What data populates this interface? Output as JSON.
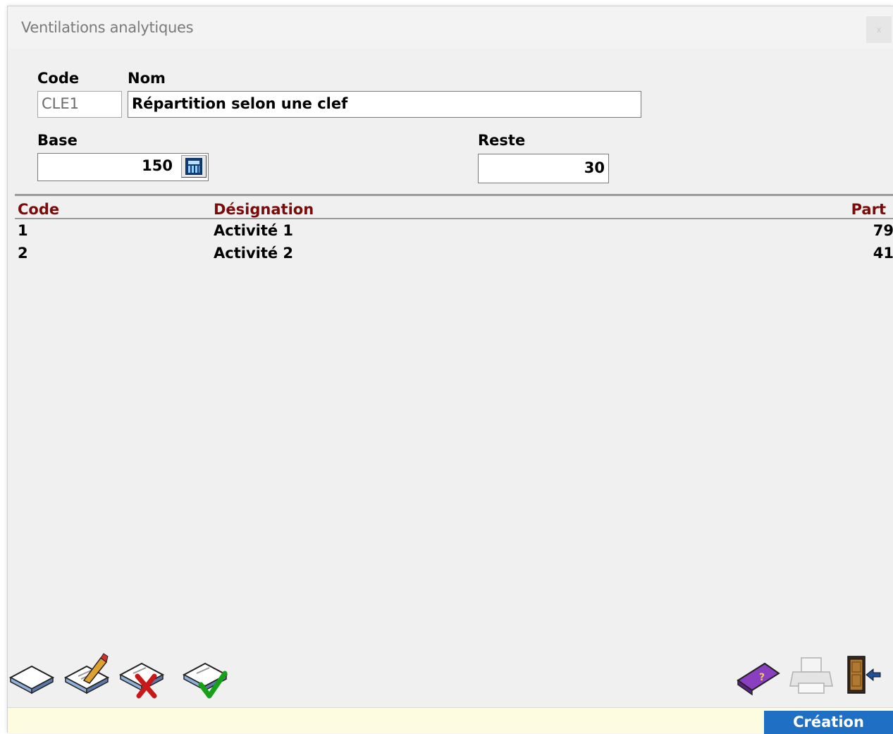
{
  "window": {
    "title": "Ventilations analytiques",
    "close_glyph": "x"
  },
  "form": {
    "code_label": "Code",
    "nom_label": "Nom",
    "code_value": "CLE1",
    "nom_value": "Répartition selon une clef",
    "base_label": "Base",
    "base_value": "150",
    "reste_label": "Reste",
    "reste_value": "30"
  },
  "table": {
    "headers": {
      "code": "Code",
      "designation": "Désignation",
      "part": "Part"
    },
    "rows": [
      {
        "code": "1",
        "designation": "Activité 1",
        "part": "79"
      },
      {
        "code": "2",
        "designation": "Activité 2",
        "part": "41"
      }
    ]
  },
  "toolbar": {
    "left": [
      "new-document-icon",
      "edit-document-icon",
      "delete-document-icon",
      "validate-document-icon"
    ],
    "right": [
      "help-book-icon",
      "printer-icon",
      "exit-door-icon"
    ]
  },
  "status": {
    "mode": "Création"
  },
  "colors": {
    "header_text": "#7b0a0a",
    "status_badge": "#1f6fc5",
    "status_bar": "#fdfbe0"
  }
}
